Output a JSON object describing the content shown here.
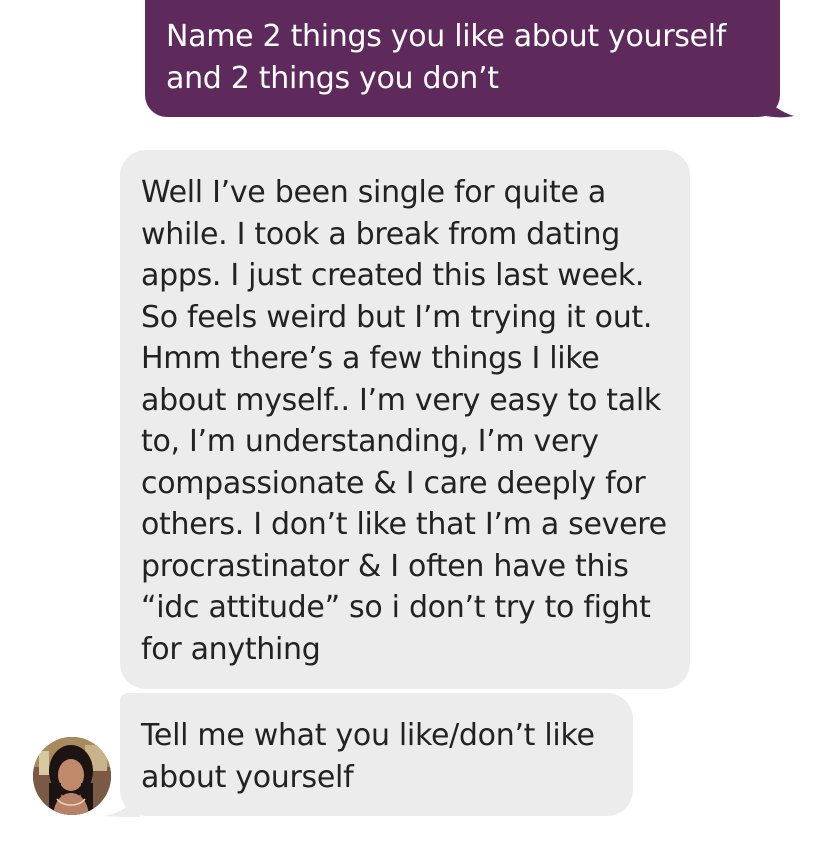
{
  "conversation": {
    "messages": [
      {
        "direction": "outgoing",
        "text": "Name 2 things you like about yourself\nand 2 things you don’t"
      },
      {
        "direction": "incoming",
        "text": "Well I’ve been single for quite a\nwhile. I took a break from dating\napps. I just created this last week.\nSo feels weird but I’m trying it out.\nHmm there’s a few things I like\nabout myself.. I’m very easy to talk\nto, I’m understanding, I’m very\ncompassionate & I care deeply for\nothers. I don’t like that I’m a severe\nprocrastinator & I often have this\n“idc attitude” so i don’t try to fight\nfor anything"
      },
      {
        "direction": "incoming",
        "text": "Tell me what you like/don’t like\nabout yourself"
      }
    ],
    "contact": {
      "avatar_icon": "profile-photo"
    }
  },
  "colors": {
    "outgoing_bubble": "#5e2a5c",
    "incoming_bubble": "#ececec",
    "outgoing_text": "#ffffff",
    "incoming_text": "#222222"
  }
}
